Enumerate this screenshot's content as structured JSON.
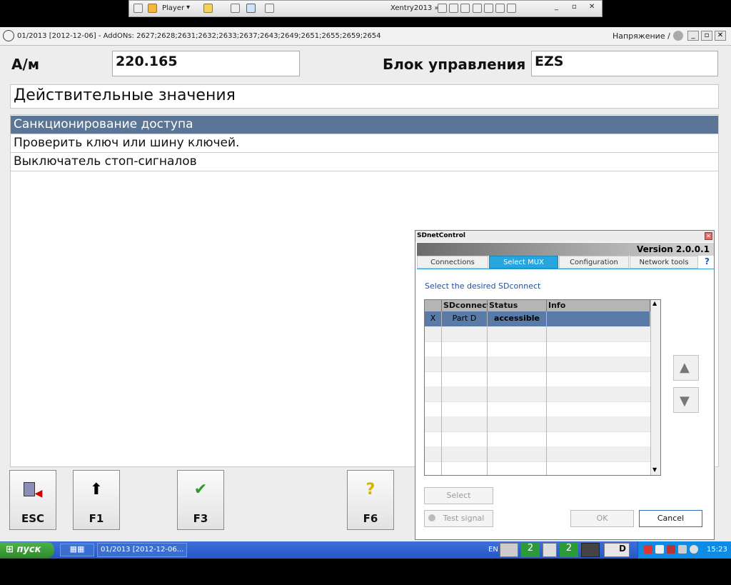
{
  "vm": {
    "player_label": "Player",
    "host_label": "Xentry2013 »"
  },
  "window": {
    "title": "01/2013 [2012-12-06] - AddONs: 2627;2628;2631;2632;2633;2637;2643;2649;2651;2655;2659;2654",
    "right_label": "Напряжение /"
  },
  "header": {
    "vehicle_label": "А/м",
    "vehicle_value": "220.165",
    "ecu_label": "Блок управления",
    "ecu_value": "EZS"
  },
  "section_title": "Действительные значения",
  "menu": [
    "Санкционирование доступа",
    "Проверить ключ или шину ключей.",
    "Выключатель стоп-сигналов"
  ],
  "fkeys": {
    "esc": "ESC",
    "f1": "F1",
    "f3": "F3",
    "f6": "F6"
  },
  "dialog": {
    "title": "SDnetControl",
    "version": "Version 2.0.0.1",
    "tabs": [
      "Connections",
      "Select MUX",
      "Configuration",
      "Network tools"
    ],
    "active_tab": "Select MUX",
    "help": "?",
    "prompt": "Select the desired SDconnect",
    "columns": [
      "SDconnect",
      "Status",
      "Info"
    ],
    "row": {
      "mark": "X",
      "name": "Part D",
      "status": "accessible",
      "info": ""
    },
    "buttons": {
      "select": "Select",
      "test_signal": "Test signal",
      "ok": "OK",
      "cancel": "Cancel"
    }
  },
  "taskbar": {
    "start": "пуск",
    "task": "01/2013 [2012-12-06...",
    "lang": "EN",
    "tray_letter": "D",
    "clock": "15:23"
  },
  "colors": {
    "selection": "#5a7596",
    "accent": "#26a5de",
    "taskbar": "#2457c7",
    "start": "#2e8b2b"
  }
}
